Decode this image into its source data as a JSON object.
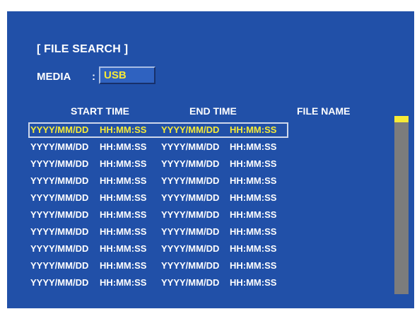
{
  "title": "[ FILE SEARCH ]",
  "media": {
    "label": "MEDIA",
    "colon": ":",
    "value": "USB"
  },
  "columns": {
    "start": "START TIME",
    "end": "END TIME",
    "file": "FILE NAME"
  },
  "rows": [
    {
      "start_date": "YYYY/MM/DD",
      "start_time": "HH:MM:SS",
      "end_date": "YYYY/MM/DD",
      "end_time": "HH:MM:SS"
    },
    {
      "start_date": "YYYY/MM/DD",
      "start_time": "HH:MM:SS",
      "end_date": "YYYY/MM/DD",
      "end_time": "HH:MM:SS"
    },
    {
      "start_date": "YYYY/MM/DD",
      "start_time": "HH:MM:SS",
      "end_date": "YYYY/MM/DD",
      "end_time": "HH:MM:SS"
    },
    {
      "start_date": "YYYY/MM/DD",
      "start_time": "HH:MM:SS",
      "end_date": "YYYY/MM/DD",
      "end_time": "HH:MM:SS"
    },
    {
      "start_date": "YYYY/MM/DD",
      "start_time": "HH:MM:SS",
      "end_date": "YYYY/MM/DD",
      "end_time": "HH:MM:SS"
    },
    {
      "start_date": "YYYY/MM/DD",
      "start_time": "HH:MM:SS",
      "end_date": "YYYY/MM/DD",
      "end_time": "HH:MM:SS"
    },
    {
      "start_date": "YYYY/MM/DD",
      "start_time": "HH:MM:SS",
      "end_date": "YYYY/MM/DD",
      "end_time": "HH:MM:SS"
    },
    {
      "start_date": "YYYY/MM/DD",
      "start_time": "HH:MM:SS",
      "end_date": "YYYY/MM/DD",
      "end_time": "HH:MM:SS"
    },
    {
      "start_date": "YYYY/MM/DD",
      "start_time": "HH:MM:SS",
      "end_date": "YYYY/MM/DD",
      "end_time": "HH:MM:SS"
    },
    {
      "start_date": "YYYY/MM/DD",
      "start_time": "HH:MM:SS",
      "end_date": "YYYY/MM/DD",
      "end_time": "HH:MM:SS"
    }
  ],
  "selected_row": 0,
  "scrollbar": {
    "position": 0
  },
  "colors": {
    "background": "#2150a8",
    "highlight_text": "#f6ea36",
    "scrollbar_track": "#7c7c7c",
    "scrollbar_thumb": "#f6ea36"
  }
}
